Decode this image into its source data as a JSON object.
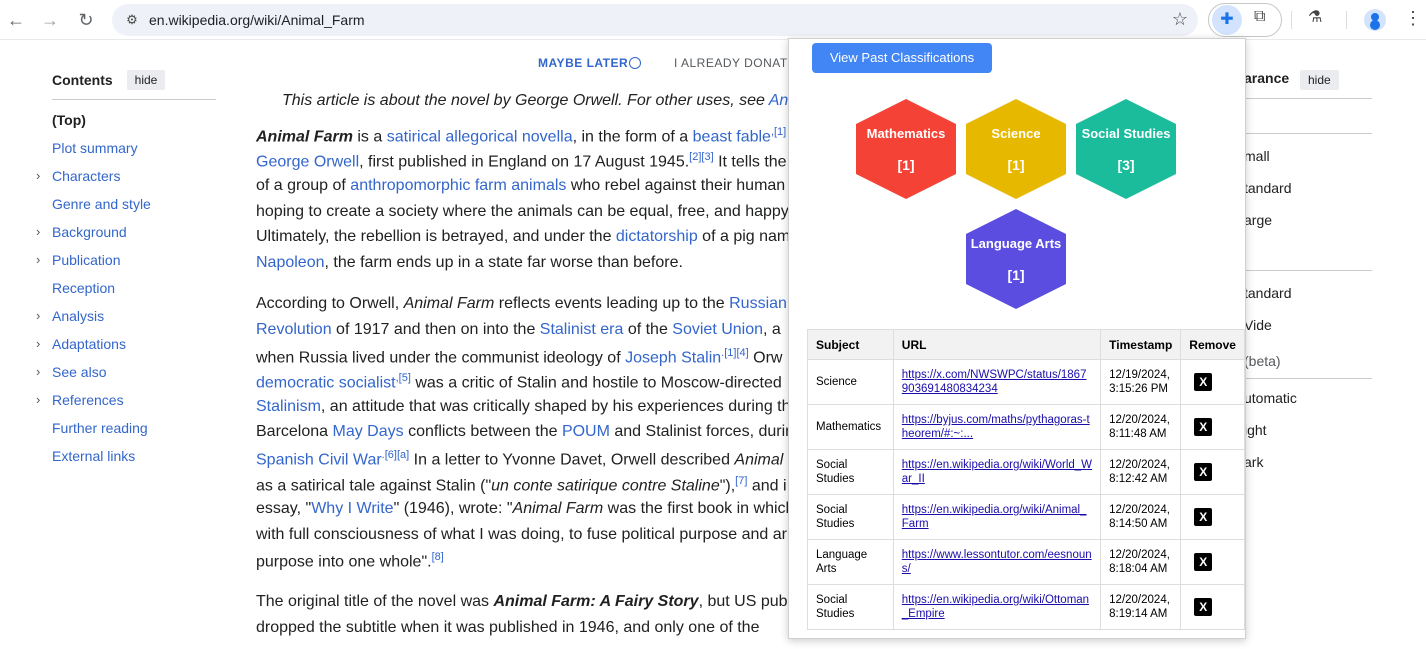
{
  "browser": {
    "url": "en.wikipedia.org/wiki/Animal_Farm",
    "icons": {
      "back": "arrow-left-icon",
      "forward": "arrow-right-icon",
      "reload": "reload-icon"
    }
  },
  "banner": {
    "maybe_later": "MAYBE LATER",
    "already_donated": "I ALREADY DONATE"
  },
  "toc": {
    "title": "Contents",
    "hide": "hide",
    "items": [
      {
        "label": "(Top)",
        "chev": false
      },
      {
        "label": "Plot summary",
        "chev": false
      },
      {
        "label": "Characters",
        "chev": true
      },
      {
        "label": "Genre and style",
        "chev": false
      },
      {
        "label": "Background",
        "chev": true
      },
      {
        "label": "Publication",
        "chev": true
      },
      {
        "label": "Reception",
        "chev": false
      },
      {
        "label": "Analysis",
        "chev": true
      },
      {
        "label": "Adaptations",
        "chev": true
      },
      {
        "label": "See also",
        "chev": true
      },
      {
        "label": "References",
        "chev": true
      },
      {
        "label": "Further reading",
        "chev": false
      },
      {
        "label": "External links",
        "chev": false
      }
    ]
  },
  "article": {
    "hatnote": "This article is about the novel by George Orwell. For other uses, see",
    "hatnote_link": "An",
    "p1": {
      "l1a": "Animal Farm",
      "l1b": " is a ",
      "l1c": "satirical allegorical novella",
      "l1d": ", in the form of a ",
      "l1e": "beast fable",
      "l1f": ",[1]",
      "l2a": "George Orwell",
      "l2b": ", first published in England on 17 August 1945.",
      "l2c": "[2][3]",
      "l2d": " It tells the",
      "l3a": "of a group of ",
      "l3b": "anthropomorphic farm animals",
      "l3c": " who rebel against their human",
      "l4": "hoping to create a society where the animals can be equal, free, and happy",
      "l5a": "Ultimately, the rebellion is betrayed, and under the ",
      "l5b": "dictatorship",
      "l5c": " of a pig nam",
      "l6a": "Napoleon",
      "l6b": ", the farm ends up in a state far worse than before."
    },
    "p2": {
      "l1a": "According to Orwell, ",
      "l1b": "Animal Farm",
      "l1c": " reflects events leading up to the ",
      "l1d": "Russian",
      "l2a": "Revolution",
      "l2b": " of 1917 and then on into the ",
      "l2c": "Stalinist era",
      "l2d": " of the ",
      "l2e": "Soviet Union",
      "l2f": ", a ",
      "l3a": "when Russia lived under the communist ideology of ",
      "l3b": "Joseph Stalin",
      "l3c": ".[1][4]",
      "l3d": " Orw",
      "l4a": "democratic socialist",
      "l4b": ",[5]",
      "l4c": " was a critic of Stalin and hostile to Moscow-directed",
      "l5a": "Stalinism",
      "l5b": ", an attitude that was critically shaped by his experiences during th",
      "l6a": "Barcelona ",
      "l6b": "May Days",
      "l6c": " conflicts between the ",
      "l6d": "POUM",
      "l6e": " and Stalinist forces, durin",
      "l7a": "Spanish Civil War",
      "l7b": ".[6][a]",
      "l7c": " In a letter to Yvonne Davet, Orwell described ",
      "l7d": "Animal",
      "l8a": "as a satirical tale against Stalin (\"",
      "l8b": "un conte satirique contre Staline",
      "l8c": "\"),",
      "l8d": "[7]",
      "l8e": " and i",
      "l9a": "essay, \"",
      "l9b": "Why I Write",
      "l9c": "\" (1946), wrote: \"",
      "l9d": "Animal Farm",
      "l9e": " was the first book in which",
      "l10": "with full consciousness of what I was doing, to fuse political purpose and ar",
      "l11a": "purpose into one whole\".",
      "l11b": "[8]"
    },
    "p3": {
      "l1a": "The original title of the novel was ",
      "l1b": "Animal Farm: A Fairy Story",
      "l1c": ", but US pub",
      "l2": "dropped the subtitle when it was published in 1946, and only one of the"
    }
  },
  "appearance": {
    "title": "arance",
    "hide": "hide",
    "options": [
      "mall",
      "tandard",
      "arge",
      "tandard",
      "Vide",
      "(beta)",
      "utomatic",
      "ight",
      "ark"
    ]
  },
  "popup": {
    "past_button": "View Past Classifications",
    "hexes": [
      {
        "name": "Mathematics",
        "count": "[1]",
        "color": "#f44336"
      },
      {
        "name": "Science",
        "count": "[1]",
        "color": "#e6b800"
      },
      {
        "name": "Social Studies",
        "count": "[3]",
        "color": "#1abc9c"
      },
      {
        "name": "Language Arts",
        "count": "[1]",
        "color": "#5b4de0"
      }
    ],
    "table": {
      "headers": [
        "Subject",
        "URL",
        "Timestamp",
        "Remove"
      ],
      "rows": [
        {
          "subject": "Science",
          "url": "https://x.com/NWSWPC/status/1867903691480834234",
          "date": "12/19/2024,",
          "time": "3:15:26 PM"
        },
        {
          "subject": "Mathematics",
          "url": "https://byjus.com/maths/pythagoras-theorem/#:~:...",
          "date": "12/20/2024,",
          "time": "8:11:48 AM"
        },
        {
          "subject": "Social Studies",
          "url": "https://en.wikipedia.org/wiki/World_War_II",
          "date": "12/20/2024,",
          "time": "8:12:42 AM"
        },
        {
          "subject": "Social Studies",
          "url": "https://en.wikipedia.org/wiki/Animal_Farm",
          "date": "12/20/2024,",
          "time": "8:14:50 AM"
        },
        {
          "subject": "Language Arts",
          "url": "https://www.lessontutor.com/eesnouns/",
          "date": "12/20/2024,",
          "time": "8:18:04 AM"
        },
        {
          "subject": "Social Studies",
          "url": "https://en.wikipedia.org/wiki/Ottoman_Empire",
          "date": "12/20/2024,",
          "time": "8:19:14 AM"
        }
      ],
      "remove_label": "X"
    }
  }
}
